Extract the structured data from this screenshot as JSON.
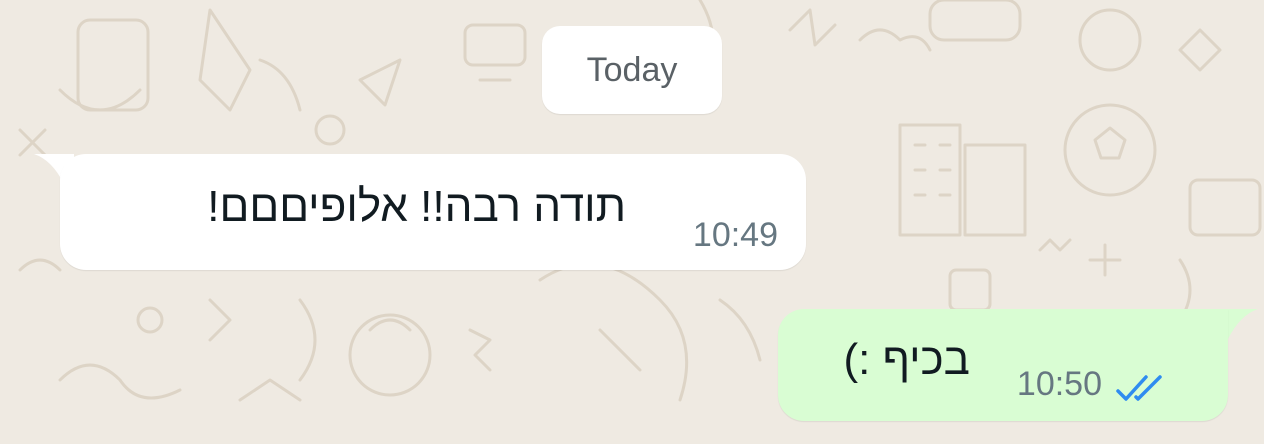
{
  "date_divider": "Today",
  "messages": [
    {
      "direction": "incoming",
      "text": "תודה רבה!! אלופיםםם!",
      "time": "10:49"
    },
    {
      "direction": "outgoing",
      "text": "בכיף :)",
      "time": "10:50",
      "status_icon": "double-check-read-icon"
    }
  ],
  "colors": {
    "background": "#efeae2",
    "incoming_bubble": "#ffffff",
    "outgoing_bubble": "#d9fdd3",
    "read_tick": "#2f8cf0",
    "time_text": "#667781"
  }
}
